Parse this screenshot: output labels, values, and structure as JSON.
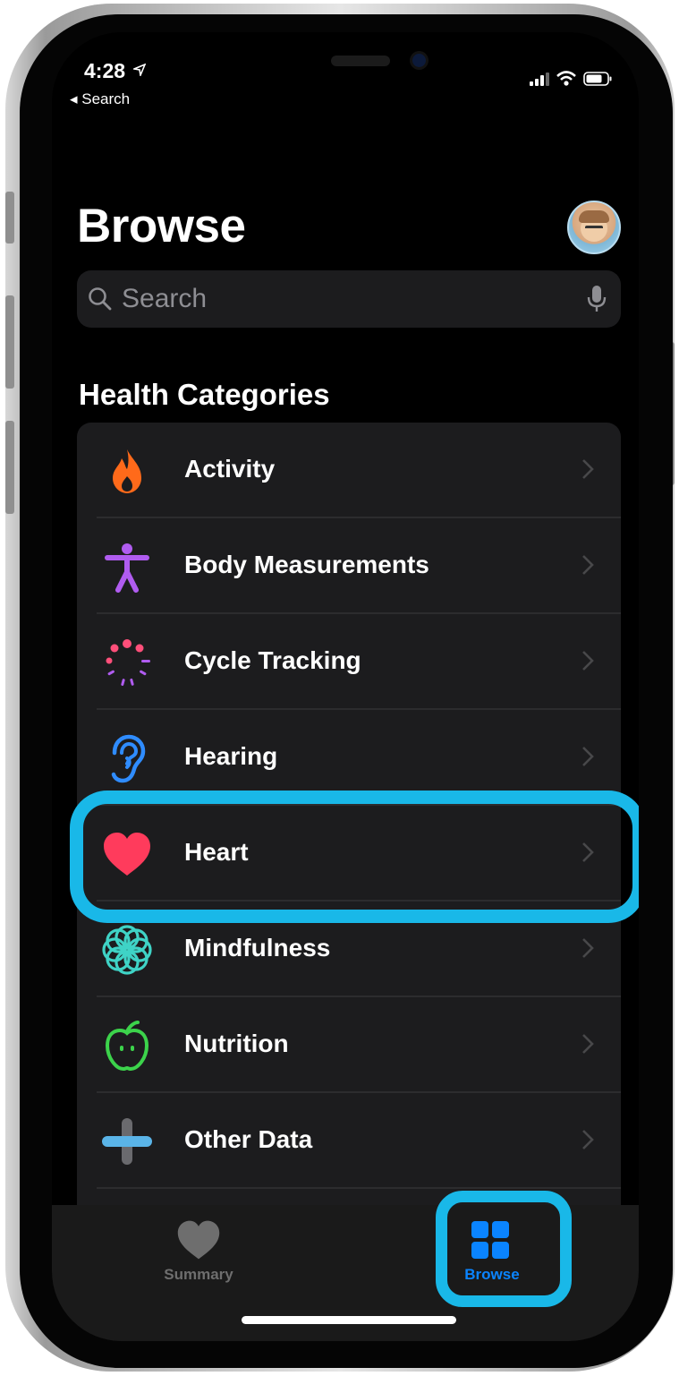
{
  "status_bar": {
    "time": "4:28",
    "back_label": "◂ Search"
  },
  "header": {
    "title": "Browse"
  },
  "search": {
    "placeholder": "Search"
  },
  "section": {
    "title": "Health Categories"
  },
  "categories": [
    {
      "label": "Activity",
      "icon": "flame-icon",
      "color": "#ff6a1a"
    },
    {
      "label": "Body Measurements",
      "icon": "figure-icon",
      "color": "#b05cf0"
    },
    {
      "label": "Cycle Tracking",
      "icon": "cycle-dots-icon",
      "color": "#ff4f7a"
    },
    {
      "label": "Hearing",
      "icon": "ear-icon",
      "color": "#2f8cff"
    },
    {
      "label": "Heart",
      "icon": "heart-icon",
      "color": "#ff3b5c"
    },
    {
      "label": "Mindfulness",
      "icon": "flower-icon",
      "color": "#3fd3c6"
    },
    {
      "label": "Nutrition",
      "icon": "apple-icon",
      "color": "#3cd34b"
    },
    {
      "label": "Other Data",
      "icon": "plus-icon",
      "color": "#5ab4e8"
    }
  ],
  "tab_bar": {
    "summary_label": "Summary",
    "browse_label": "Browse",
    "active_color": "#0a84ff",
    "inactive_color": "#6e6e6e"
  },
  "highlight_color": "#19b8e8"
}
